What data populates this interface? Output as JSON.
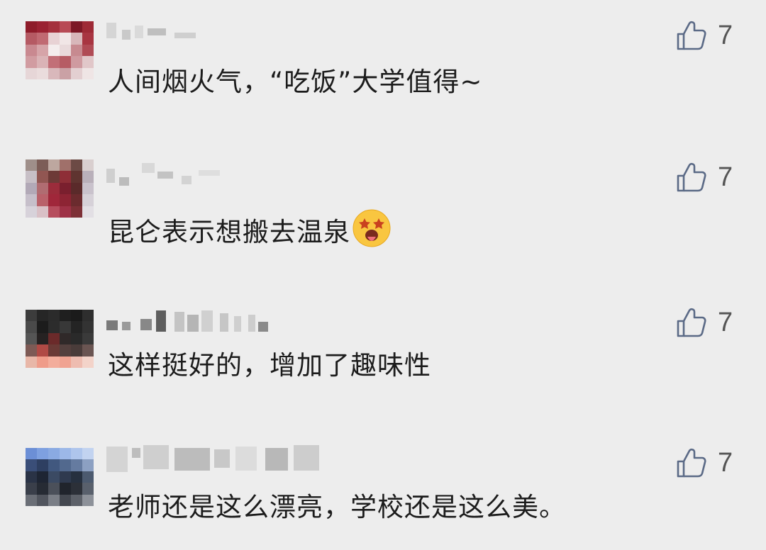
{
  "comments": [
    {
      "text": "人间烟火气，“吃饭”大学值得~",
      "likes": "7",
      "avatar_colors": [
        "#8e1c2a",
        "#9a2232",
        "#a4303c",
        "#b84a55",
        "#7d1826",
        "#9e2a36",
        "#b55a63",
        "#c06a72",
        "#e8d2d4",
        "#f1e6e6",
        "#d8b7ba",
        "#a83541",
        "#c98990",
        "#d6a4a8",
        "#f4eded",
        "#e9dadb",
        "#c78a90",
        "#b04b55",
        "#d19ca1",
        "#dab3b6",
        "#c26f77",
        "#b65c64",
        "#cf9aa0",
        "#e1c7c9",
        "#e6d6d7",
        "#eadcdc",
        "#d9b8bb",
        "#caa1a5",
        "#e3cfd1",
        "#efe5e5"
      ]
    },
    {
      "text": "昆仑表示想搬去温泉",
      "emoji": "star-struck-tongue-emoji",
      "likes": "7",
      "avatar_colors": [
        "#9f8f8a",
        "#7c5d57",
        "#bda79f",
        "#a0706a",
        "#6c4a45",
        "#d9cfcf",
        "#c7bfc6",
        "#915652",
        "#6d3a37",
        "#8e2e37",
        "#5f3430",
        "#b9b0ba",
        "#b2a9b7",
        "#b06c71",
        "#9b2c3b",
        "#7a1f2e",
        "#5a2a2a",
        "#c9c2cc",
        "#c6bfca",
        "#b9616a",
        "#a0273a",
        "#8d2434",
        "#6b2b2e",
        "#d6d1d8",
        "#d7d2da",
        "#d9c0c6",
        "#b64d5d",
        "#9e3146",
        "#7d3036",
        "#e2dfe4"
      ]
    },
    {
      "text": "这样挺好的，增加了趣味性",
      "likes": "7",
      "avatar_colors": [
        "#3c3c3c",
        "#262626",
        "#2b2b2b",
        "#1f1f1f",
        "#1b1b1b",
        "#2e2e2e",
        "#4a4a4a",
        "#1c1c1c",
        "#2c2c2c",
        "#383838",
        "#242424",
        "#333333",
        "#555555",
        "#262222",
        "#6b2a2a",
        "#302929",
        "#2a2a2a",
        "#3a3a3a",
        "#7d5a55",
        "#b04a45",
        "#6a3a36",
        "#54403e",
        "#4a3c3a",
        "#6a5552",
        "#e8b7a8",
        "#ef9c8a",
        "#f3ad9c",
        "#f0a392",
        "#eebcb0",
        "#f3d3c9"
      ]
    },
    {
      "text": "老师还是这么漂亮，学校还是这么美。",
      "likes": "7",
      "avatar_colors": [
        "#6c8fd6",
        "#7ea0e0",
        "#8aaae2",
        "#9cb8e8",
        "#aec5ec",
        "#c2d3f0",
        "#3a4e78",
        "#2e3f61",
        "#41587f",
        "#52698e",
        "#657ba0",
        "#8ca0c2",
        "#2a3346",
        "#1e2533",
        "#3b4a63",
        "#2f3a4f",
        "#26303f",
        "#4c5a6f",
        "#3a3f4a",
        "#262b34",
        "#4b505a",
        "#20242c",
        "#2c3038",
        "#59606c",
        "#6a6e76",
        "#51555e",
        "#7a7e86",
        "#444850",
        "#5d6169",
        "#8d9199"
      ]
    }
  ]
}
